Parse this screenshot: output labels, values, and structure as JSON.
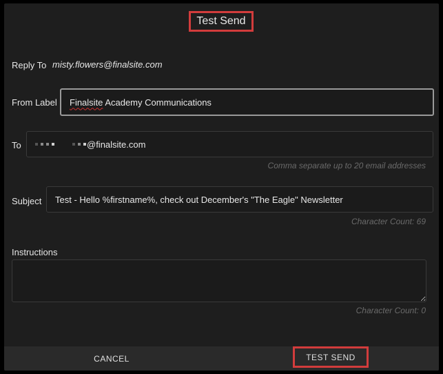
{
  "dialog": {
    "title": "Test Send"
  },
  "reply_to": {
    "label": "Reply To",
    "value": "misty.flowers@finalsite.com"
  },
  "from_label": {
    "label": "From Label",
    "value_prefix": "Finalsite",
    "value_rest": " Academy Communications"
  },
  "to": {
    "label": "To",
    "value_suffix": "@finalsite.com",
    "hint": "Comma separate up to 20 email addresses"
  },
  "subject": {
    "label": "Subject",
    "value": "Test - Hello %firstname%, check out December's \"The Eagle\" Newsletter",
    "char_count": "Character Count: 69"
  },
  "instructions": {
    "label": "Instructions",
    "value": "",
    "char_count": "Character Count: 0"
  },
  "footer": {
    "cancel_label": "CANCEL",
    "send_label": "TEST SEND"
  },
  "colors": {
    "highlight_border": "#d23c3c",
    "dialog_bg": "#1e1e1e",
    "footer_bg": "#2a2a2a"
  }
}
